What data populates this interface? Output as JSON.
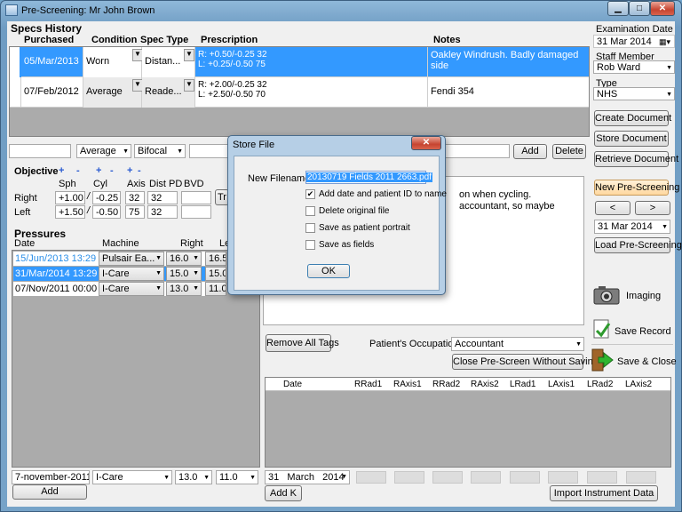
{
  "window": {
    "title": "Pre-Screening: Mr John Brown",
    "min_glyph": "▁",
    "max_glyph": "□",
    "close_glyph": "✕"
  },
  "specs": {
    "heading": "Specs History",
    "columns": {
      "purchased": "Purchased",
      "condition": "Condition",
      "spec_type": "Spec Type",
      "prescription": "Prescription",
      "notes": "Notes"
    },
    "rows": [
      {
        "date": "05/Mar/2013",
        "condition": "Worn",
        "type": "Distan...",
        "rx1": "R: +0.50/-0.25 32",
        "rx2": "L: +0.25/-0.50 75",
        "notes": "Oakley Windrush. Badly damaged side"
      },
      {
        "date": "07/Feb/2012",
        "condition": "Average",
        "type": "Reade...",
        "rx1": "R: +2.00/-0.25 32",
        "rx2": "L: +2.50/-0.50 70",
        "notes": "Fendi 354"
      }
    ],
    "new_condition": "Average",
    "new_type": "Bifocal",
    "add_label": "Add",
    "delete_label": "Delete"
  },
  "objective": {
    "heading": "Objective",
    "plus": "+",
    "minus": "-",
    "columns": {
      "sph": "Sph",
      "cyl": "Cyl",
      "axis": "Axis",
      "dist_pd": "Dist PD",
      "bvd": "BVD"
    },
    "right_label": "Right",
    "left_label": "Left",
    "slash": "/",
    "right": {
      "sph": "+1.00",
      "cyl": "-0.25",
      "axis": "32",
      "pd": "32"
    },
    "left": {
      "sph": "+1.50",
      "cyl": "-0.50",
      "axis": "75",
      "pd": "32"
    },
    "tr_label": "Tr"
  },
  "pressures": {
    "heading": "Pressures",
    "columns": {
      "date": "Date",
      "machine": "Machine",
      "right": "Right",
      "left": "Le"
    },
    "rows": [
      {
        "date": "15/Jun/2013 13:29",
        "machine": "Pulsair Ea...",
        "right": "16.0",
        "left": "16.5"
      },
      {
        "date": "31/Mar/2014 13:29",
        "machine": "I-Care",
        "right": "15.0",
        "left": "15.0"
      },
      {
        "date": "07/Nov/2011 00:00",
        "machine": "I-Care",
        "right": "13.0",
        "left": "11.0"
      }
    ],
    "new_date": "7-november-2011",
    "new_machine": "I-Care",
    "new_right": "13.0",
    "new_left": "11.0",
    "add_label": "Add"
  },
  "notes": {
    "line1": "on when cycling.",
    "line2": "accountant, so maybe",
    "remove_tags_label": "Remove All Tags",
    "occupation_label": "Patient's Occupation",
    "occupation_value": "Accountant",
    "close_without_saving_label": "Close Pre-Screen Without Saving"
  },
  "instrument": {
    "columns": [
      "Date",
      "RRad1",
      "RAxis1",
      "RRad2",
      "RAxis2",
      "LRad1",
      "LAxis1",
      "LRad2",
      "LAxis2"
    ],
    "day": "31",
    "month": "March",
    "year": "2014",
    "add_k_label": "Add K",
    "import_label": "Import Instrument Data"
  },
  "right_panel": {
    "exam_date_label": "Examination Date",
    "exam_date": "31 Mar 2014",
    "staff_label": "Staff Member",
    "staff_value": "Rob Ward",
    "type_label": "Type",
    "type_value": "NHS",
    "create_document": "Create Document",
    "store_document": "Store Document",
    "retrieve_document": "Retrieve Document",
    "new_prescreening": "New Pre-Screening",
    "prev_glyph": "<",
    "next_glyph": ">",
    "load_date": "31 Mar 2014",
    "load_prescreening": "Load Pre-Screening",
    "imaging": "Imaging",
    "save_record": "Save Record",
    "save_close": "Save & Close"
  },
  "dialog": {
    "title": "Store File",
    "close_glyph": "✕",
    "filename_label": "New Filename:",
    "filename_value": "20130719 Fields 2011 2663.pdf",
    "options": [
      {
        "label": "Add date and patient ID to name",
        "checked": true
      },
      {
        "label": "Delete original file",
        "checked": false
      },
      {
        "label": "Save as patient portrait",
        "checked": false
      },
      {
        "label": "Save as fields",
        "checked": false
      }
    ],
    "ok_label": "OK"
  },
  "colors": {
    "selection": "#3399ff",
    "highlight_button": "#ffd8a0"
  }
}
